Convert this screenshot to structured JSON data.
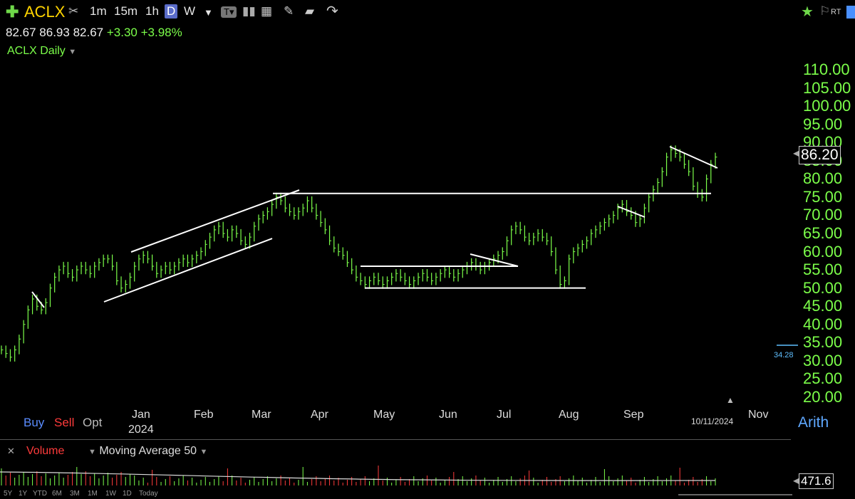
{
  "toolbar": {
    "symbol": "ACLX",
    "intervals": [
      "1m",
      "15m",
      "1h",
      "D",
      "W"
    ],
    "active_interval": "D",
    "flags": "RT"
  },
  "quote": {
    "open": "82.67",
    "high": "86.93",
    "low": "82.67",
    "change": "+3.30",
    "change_pct": "+3.98%"
  },
  "chart_title": "ACLX Daily",
  "chart_data": {
    "type": "bar",
    "x_axis_months": [
      "Jan",
      "Feb",
      "Mar",
      "Apr",
      "May",
      "Jun",
      "Jul",
      "Aug",
      "Sep",
      "Nov"
    ],
    "year_label": "2024",
    "date_label": "10/11/2024",
    "y_ticks": [
      "110.00",
      "105.00",
      "100.00",
      "95.00",
      "90.00",
      "85.00",
      "80.00",
      "75.00",
      "70.00",
      "65.00",
      "60.00",
      "55.00",
      "50.00",
      "45.00",
      "40.00",
      "35.00",
      "30.00",
      "25.00",
      "20.00"
    ],
    "ylim": [
      20,
      110
    ],
    "last_price": "86.20",
    "low_marker": "34.28",
    "scale": "Arith",
    "closes": [
      33,
      32,
      31,
      33,
      36,
      40,
      44,
      47,
      45,
      44,
      46,
      50,
      53,
      55,
      56,
      54,
      53,
      55,
      56,
      55,
      54,
      56,
      57,
      58,
      58,
      56,
      52,
      50,
      51,
      53,
      56,
      58,
      59,
      58,
      56,
      54,
      55,
      56,
      55,
      56,
      57,
      58,
      57,
      58,
      59,
      60,
      62,
      64,
      66,
      67,
      65,
      64,
      66,
      65,
      63,
      62,
      64,
      67,
      69,
      70,
      71,
      73,
      75,
      74,
      72,
      71,
      70,
      71,
      72,
      74,
      72,
      70,
      68,
      66,
      63,
      61,
      60,
      59,
      57,
      55,
      53,
      52,
      51,
      52,
      53,
      52,
      51,
      52,
      53,
      54,
      53,
      52,
      51,
      52,
      53,
      54,
      53,
      52,
      53,
      54,
      55,
      54,
      53,
      54,
      55,
      56,
      57,
      56,
      55,
      56,
      57,
      58,
      59,
      60,
      63,
      66,
      67,
      66,
      64,
      63,
      64,
      65,
      64,
      63,
      60,
      55,
      51,
      52,
      58,
      60,
      61,
      62,
      63,
      65,
      66,
      67,
      68,
      69,
      70,
      72,
      73,
      71,
      70,
      68,
      69,
      72,
      75,
      77,
      79,
      82,
      86,
      88,
      87,
      86,
      84,
      82,
      78,
      76,
      75,
      80,
      84,
      86
    ]
  },
  "drawings": {
    "horizontal_levels": [
      76,
      56,
      50
    ],
    "channel": "rising"
  },
  "trade_buttons": {
    "buy": "Buy",
    "sell": "Sell",
    "opt": "Opt"
  },
  "volume_panel": {
    "label": "Volume",
    "indicator": "Moving Average 50",
    "last_value": "471.6",
    "colors": {
      "up": "#7cff4a",
      "down": "#ff3b3b"
    }
  },
  "ranges": [
    "5Y",
    "1Y",
    "YTD",
    "6M",
    "3M",
    "1M",
    "1W",
    "1D",
    "Today"
  ],
  "colors": {
    "accent": "#7cff4a",
    "symbol": "#ffd400",
    "trendline": "#ffffff",
    "down": "#ff3b3b",
    "blue": "#5a8cff"
  }
}
